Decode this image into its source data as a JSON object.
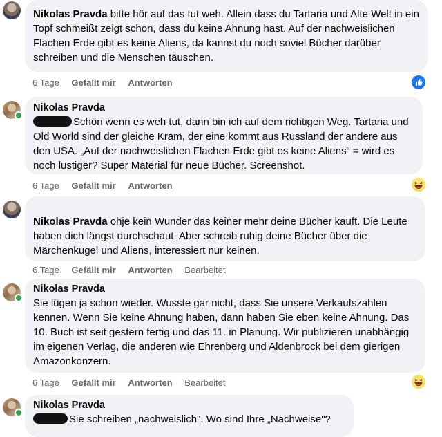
{
  "comments": [
    {
      "author": "Nikolas Pravda",
      "text": "bitte hör auf das tut weh. Allein dass du Tartaria und Alte Welt in ein Topf schmeißt zeigt schon, dass du keine Ahnung hast. Auf der nachweislichen Flachen Erde gibt es keine Aliens, da kannst du noch soviel Bücher darüber schreiben und die Menschen täuschen.",
      "time": "6 Tage",
      "like": "Gefällt mir",
      "reply": "Antworten",
      "reaction_icon": "like-icon"
    },
    {
      "author": "Nikolas Pravda",
      "text": "Schön wenn es weh tut, dann bin ich auf dem richtigen Weg. Tartaria und Old World sind der gleiche Kram, der eine kommt aus Russland der andere aus den USA. „Auf der nachweislichen Flachen Erde gibt es keine Aliens“ = wird es noch lustiger? Super Material für neue Bücher. Screenshot.",
      "time": "6 Tage",
      "like": "Gefällt mir",
      "reply": "Antworten",
      "reaction_icon": "haha-icon"
    },
    {
      "author": "Nikolas Pravda",
      "text": "ohje kein Wunder das keiner mehr deine Bücher kauft. Die Leute haben dich längst durchschaut. Aber schreib ruhig deine Bücher über die Märchenkugel und Aliens, interessiert nur keinen.",
      "time": "6 Tage",
      "like": "Gefällt mir",
      "reply": "Antworten",
      "edited": "Bearbeitet"
    },
    {
      "author": "Nikolas Pravda",
      "text": "Sie lügen ja schon wieder. Wusste gar nicht, dass Sie unsere Verkaufszahlen kennen. Wenn Sie keine Ahnung haben, dann haben Sie eben keine Ahnung. Das 10. Buch ist seit gestern fertig und das 11. in Planung. Wir publizieren unabhängig im eigenen Verlag, die anderen wie Ehrenberg und Aldenbrock bei dem gierigen Amazonkonzern.",
      "time": "6 Tage",
      "like": "Gefällt mir",
      "reply": "Antworten",
      "edited": "Bearbeitet",
      "reaction_icon": "haha-icon"
    },
    {
      "author": "Nikolas Pravda",
      "text": "Sie schreiben „nachweislich\". Wo sind Ihre „Nachweise\"?"
    }
  ],
  "colors": {
    "bubble": "#f0f2f5",
    "meta": "#65676b",
    "like_blue": "#1877f2",
    "online": "#31a24c"
  }
}
